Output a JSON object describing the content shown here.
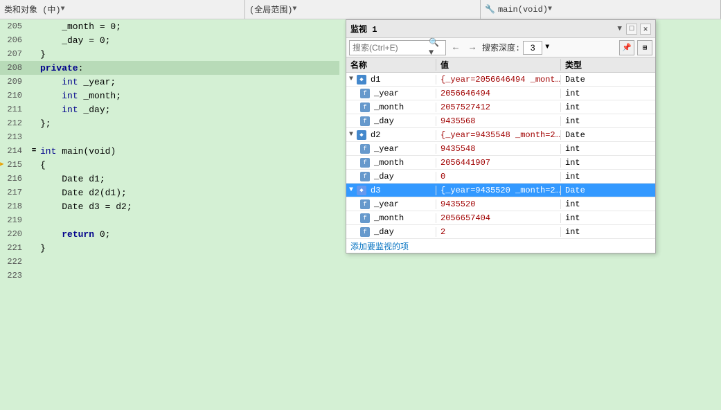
{
  "toolbar": {
    "seg1_label": "类和对象 (中)",
    "seg2_label": "(全局范围)",
    "seg3_icon": "🔧",
    "seg3_label": "main(void)"
  },
  "code": {
    "lines": [
      {
        "num": "205",
        "marker": "",
        "content": "    _month = 0;",
        "highlight": false
      },
      {
        "num": "206",
        "marker": "",
        "content": "    _day = 0;",
        "highlight": false
      },
      {
        "num": "207",
        "marker": "",
        "content": "}",
        "highlight": false
      },
      {
        "num": "208",
        "marker": "",
        "content": "private:",
        "highlight": true
      },
      {
        "num": "209",
        "marker": "",
        "content": "    int _year;",
        "highlight": false
      },
      {
        "num": "210",
        "marker": "",
        "content": "    int _month;",
        "highlight": false
      },
      {
        "num": "211",
        "marker": "",
        "content": "    int _day;",
        "highlight": false
      },
      {
        "num": "212",
        "marker": "",
        "content": "};",
        "highlight": false
      },
      {
        "num": "213",
        "marker": "",
        "content": "",
        "highlight": false
      },
      {
        "num": "214",
        "marker": "=",
        "content": "int main(void)",
        "highlight": false
      },
      {
        "num": "215",
        "marker": "",
        "content": "{",
        "highlight": false
      },
      {
        "num": "216",
        "marker": "",
        "content": "    Date d1;",
        "highlight": false
      },
      {
        "num": "217",
        "marker": "",
        "content": "    Date d2(d1);",
        "highlight": false
      },
      {
        "num": "218",
        "marker": "",
        "content": "    Date d3 = d2;",
        "highlight": false
      },
      {
        "num": "219",
        "marker": "",
        "content": "",
        "highlight": false
      },
      {
        "num": "220",
        "marker": "",
        "content": "    return 0;",
        "highlight": false
      },
      {
        "num": "221",
        "marker": "",
        "content": "}",
        "highlight": false
      },
      {
        "num": "222",
        "marker": "",
        "content": "",
        "highlight": false
      },
      {
        "num": "223",
        "marker": "",
        "content": "",
        "highlight": false
      }
    ],
    "arrow_line": 14
  },
  "watch": {
    "title": "监视 1",
    "search_placeholder": "搜索(Ctrl+E)",
    "search_depth_label": "搜索深度:",
    "search_depth_value": "3",
    "columns": {
      "name": "名称",
      "value": "值",
      "type": "类型"
    },
    "rows": [
      {
        "id": "d1",
        "name": "d1",
        "value": "{_year=2056646494 _month...",
        "type": "Date",
        "expanded": true,
        "level": 0,
        "is_object": true,
        "selected": false,
        "children": [
          {
            "name": "_year",
            "value": "2056646494",
            "type": "int",
            "level": 1
          },
          {
            "name": "_month",
            "value": "2057527412",
            "type": "int",
            "level": 1
          },
          {
            "name": "_day",
            "value": "9435568",
            "type": "int",
            "level": 1
          }
        ]
      },
      {
        "id": "d2",
        "name": "d2",
        "value": "{_year=9435548 _month=20...",
        "type": "Date",
        "expanded": true,
        "level": 0,
        "is_object": true,
        "selected": false,
        "children": [
          {
            "name": "_year",
            "value": "9435548",
            "type": "int",
            "level": 1
          },
          {
            "name": "_month",
            "value": "2056441907",
            "type": "int",
            "level": 1
          },
          {
            "name": "_day",
            "value": "0",
            "type": "int",
            "level": 1
          }
        ]
      },
      {
        "id": "d3",
        "name": "d3",
        "value": "{_year=9435520 _month=20...",
        "type": "Date",
        "expanded": true,
        "level": 0,
        "is_object": true,
        "selected": true,
        "children": [
          {
            "name": "_year",
            "value": "9435520",
            "type": "int",
            "level": 1
          },
          {
            "name": "_month",
            "value": "2056657404",
            "type": "int",
            "level": 1
          },
          {
            "name": "_day",
            "value": "2",
            "type": "int",
            "level": 1
          }
        ]
      }
    ],
    "add_label": "添加要监视的项"
  }
}
